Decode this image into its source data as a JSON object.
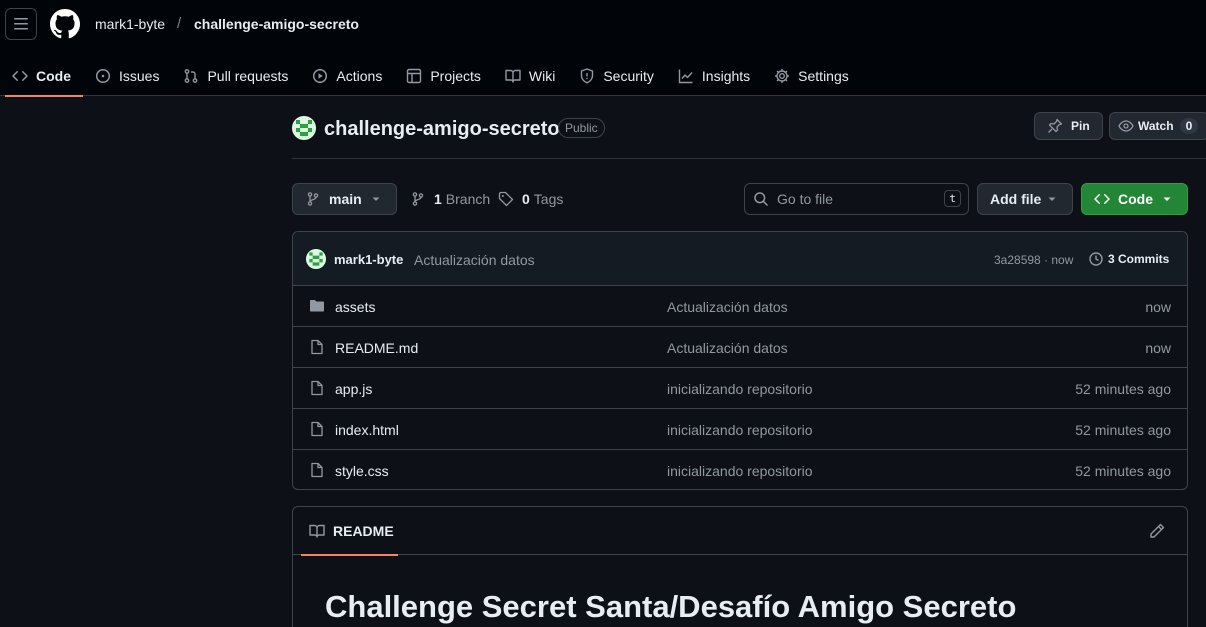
{
  "header": {
    "owner": "mark1-byte",
    "separator": "/",
    "repo": "challenge-amigo-secreto"
  },
  "nav": {
    "tabs": [
      {
        "label": "Code",
        "icon": "code-icon",
        "active": true
      },
      {
        "label": "Issues",
        "icon": "issue-icon"
      },
      {
        "label": "Pull requests",
        "icon": "pull-request-icon"
      },
      {
        "label": "Actions",
        "icon": "play-icon"
      },
      {
        "label": "Projects",
        "icon": "table-icon"
      },
      {
        "label": "Wiki",
        "icon": "book-icon"
      },
      {
        "label": "Security",
        "icon": "shield-icon"
      },
      {
        "label": "Insights",
        "icon": "graph-icon"
      },
      {
        "label": "Settings",
        "icon": "gear-icon"
      }
    ]
  },
  "repo": {
    "title": "challenge-amigo-secreto",
    "visibility": "Public",
    "pin_label": "Pin",
    "watch_label": "Watch",
    "watch_count": "0"
  },
  "toolbar": {
    "branch": "main",
    "branch_count": "1",
    "branch_label": "Branch",
    "tag_count": "0",
    "tag_label": "Tags",
    "search_placeholder": "Go to file",
    "search_key": "t",
    "add_file_label": "Add file",
    "code_label": "Code"
  },
  "latest_commit": {
    "author": "mark1-byte",
    "message": "Actualización datos",
    "sha_time": "3a28598 · now",
    "commits_label": "3 Commits"
  },
  "files": [
    {
      "name": "assets",
      "type": "folder",
      "message": "Actualización datos",
      "time": "now"
    },
    {
      "name": "README.md",
      "type": "file",
      "message": "Actualización datos",
      "time": "now"
    },
    {
      "name": "app.js",
      "type": "file",
      "message": "inicializando repositorio",
      "time": "52 minutes ago"
    },
    {
      "name": "index.html",
      "type": "file",
      "message": "inicializando repositorio",
      "time": "52 minutes ago"
    },
    {
      "name": "style.css",
      "type": "file",
      "message": "inicializando repositorio",
      "time": "52 minutes ago"
    }
  ],
  "readme": {
    "tab_label": "README",
    "heading": "Challenge Secret Santa/Desafío Amigo Secreto"
  },
  "colors": {
    "accent_underline": "#f78166",
    "code_button": "#238636",
    "background": "#0d1117"
  }
}
